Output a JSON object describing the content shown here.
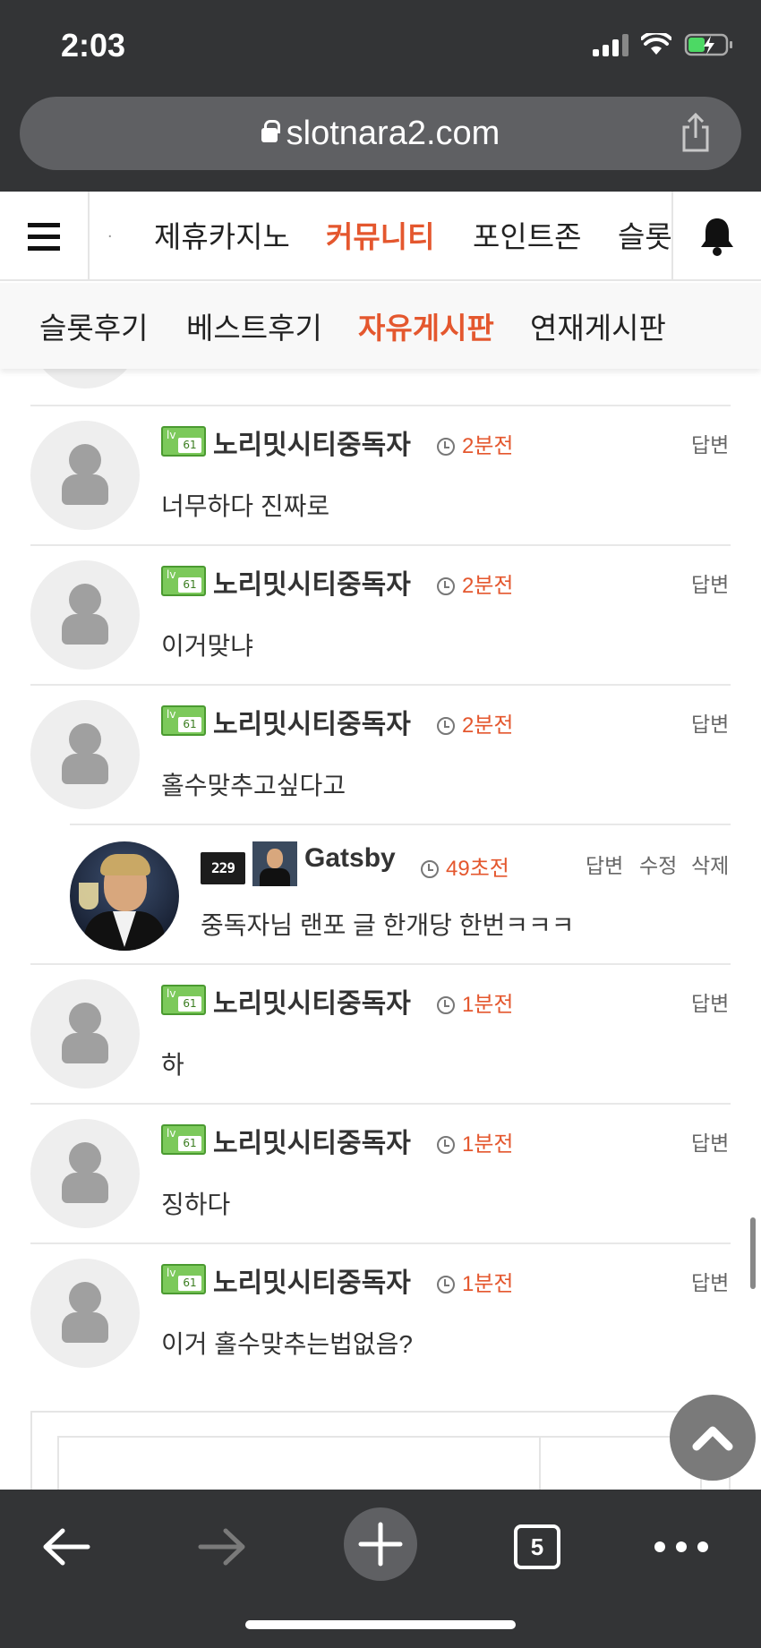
{
  "status": {
    "time": "2:03"
  },
  "browser": {
    "url": "slotnara2.com",
    "tab_count": "5"
  },
  "nav": {
    "items": [
      {
        "label": "제휴카지노",
        "active": false
      },
      {
        "label": "커뮤니티",
        "active": true
      },
      {
        "label": "포인트존",
        "active": false
      },
      {
        "label": "슬롯",
        "active": false
      }
    ]
  },
  "subnav": {
    "items": [
      {
        "label": "슬롯후기",
        "active": false
      },
      {
        "label": "베스트후기",
        "active": false
      },
      {
        "label": "자유게시판",
        "active": true
      },
      {
        "label": "연재게시판",
        "active": false
      }
    ]
  },
  "comments": [
    {
      "author": "노리밋시티중독자",
      "level": "61",
      "time": "2분전",
      "text": "너무하다 진짜로",
      "actions": [
        "답변"
      ]
    },
    {
      "author": "노리밋시티중독자",
      "level": "61",
      "time": "2분전",
      "text": "이거맞냐",
      "actions": [
        "답변"
      ]
    },
    {
      "author": "노리밋시티중독자",
      "level": "61",
      "time": "2분전",
      "text": "홀수맞추고싶다고",
      "actions": [
        "답변"
      ]
    },
    {
      "author": "Gatsby",
      "rank": "229",
      "time": "49초전",
      "text": "중독자님 랜포 글 한개당 한번ㅋㅋㅋ",
      "actions": [
        "답변",
        "수정",
        "삭제"
      ],
      "reply": true
    },
    {
      "author": "노리밋시티중독자",
      "level": "61",
      "time": "1분전",
      "text": "하",
      "actions": [
        "답변"
      ]
    },
    {
      "author": "노리밋시티중독자",
      "level": "61",
      "time": "1분전",
      "text": "징하다",
      "actions": [
        "답변"
      ]
    },
    {
      "author": "노리밋시티중독자",
      "level": "61",
      "time": "1분전",
      "text": "이거 홀수맞추는법없음?",
      "actions": [
        "답변"
      ]
    }
  ],
  "colors": {
    "accent": "#e4572e",
    "chrome": "#333436",
    "level_badge": "#7cc95b"
  }
}
